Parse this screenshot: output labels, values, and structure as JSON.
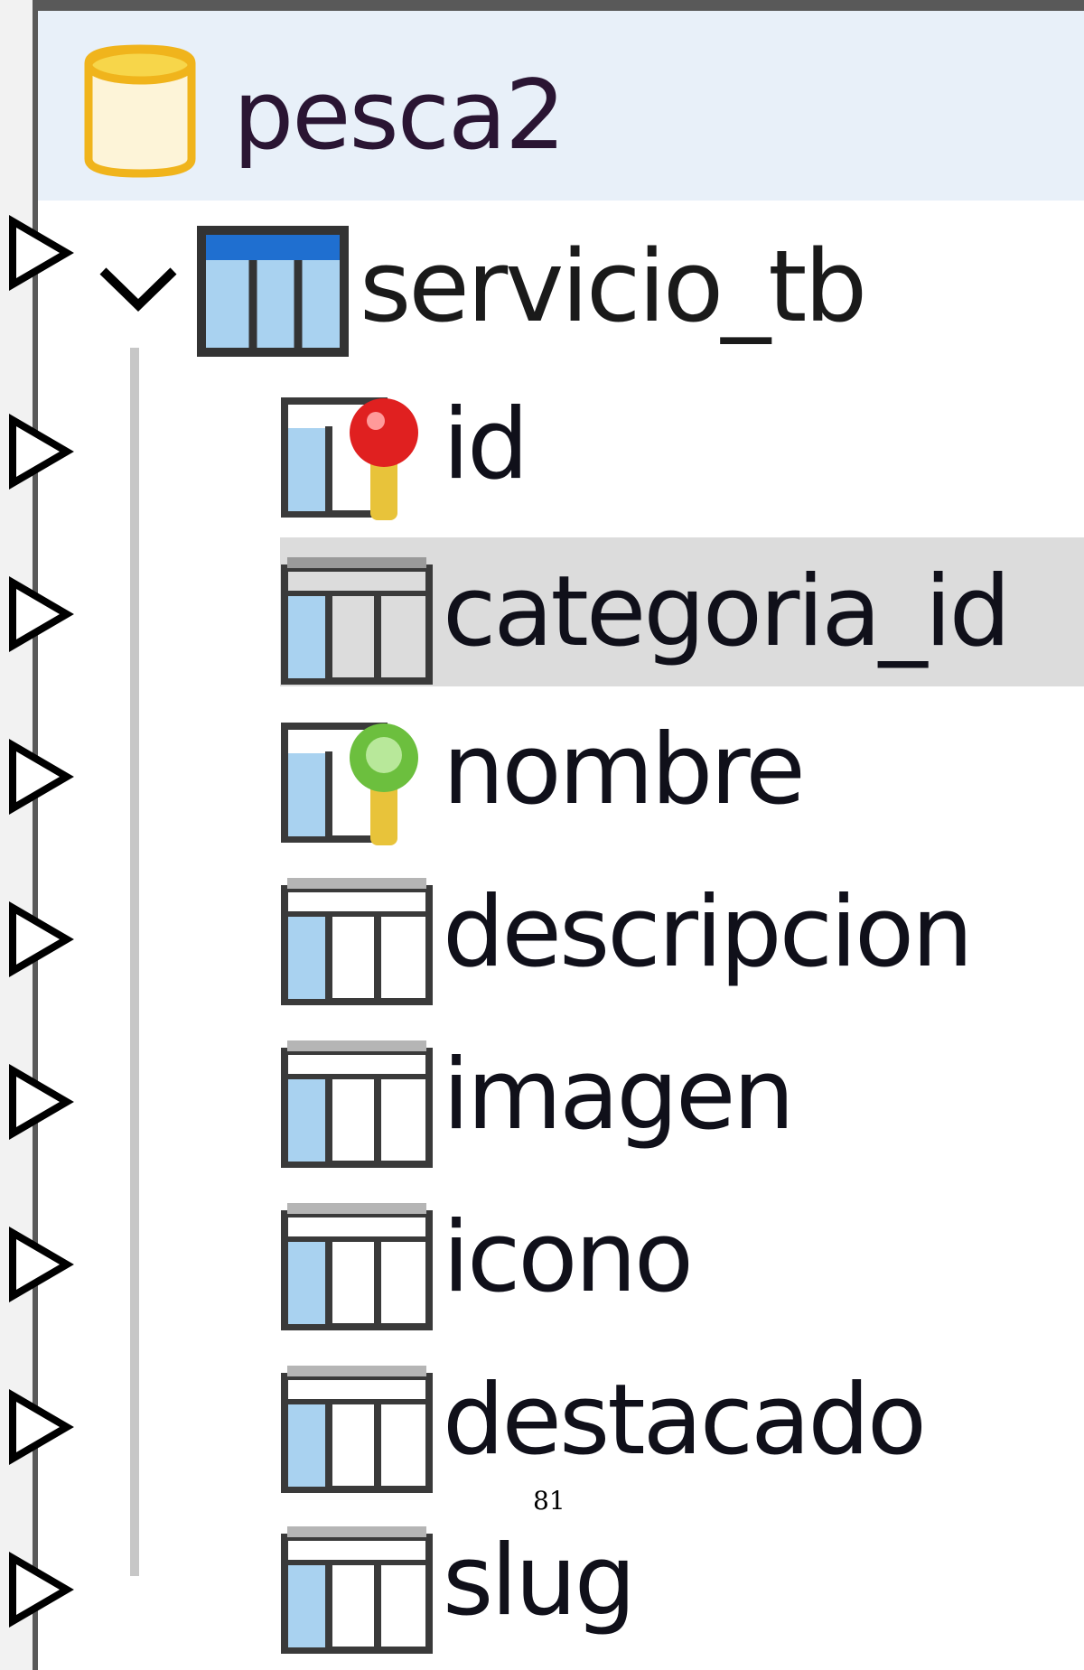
{
  "database": {
    "name": "pesca2",
    "icon": "database-icon"
  },
  "table": {
    "name": "servicio_tb",
    "icon": "table-icon",
    "expanded": true
  },
  "columns": [
    {
      "name": "id",
      "key": "primary"
    },
    {
      "name": "categoria_id",
      "selected": true
    },
    {
      "name": "nombre",
      "key": "unique"
    },
    {
      "name": "descripcion"
    },
    {
      "name": "imagen"
    },
    {
      "name": "icono"
    },
    {
      "name": "destacado"
    },
    {
      "name": "slug"
    }
  ],
  "page_number": "81",
  "colors": {
    "tree_background": "#ffffff",
    "db_row_highlight": "#e8f0f9",
    "selected_row": "#dcdcdc",
    "table_icon_header": "#1f6fd0",
    "table_icon_fill": "#a9d2f0",
    "primary_key_head": "#e02020",
    "unique_key_head": "#6cbf3e",
    "key_body": "#e8c33a",
    "db_icon": "#f2c232"
  }
}
